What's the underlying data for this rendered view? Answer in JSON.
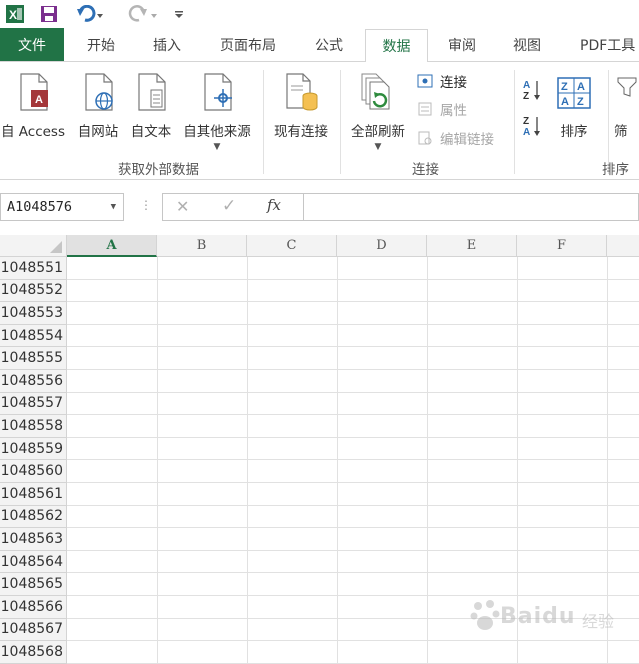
{
  "qat": {
    "app_icon": "excel-icon",
    "save_icon": "save-icon",
    "undo_icon": "undo-icon",
    "redo_icon": "redo-icon",
    "customize_icon": "customize-icon"
  },
  "tabs": [
    {
      "label": "文件"
    },
    {
      "label": "开始"
    },
    {
      "label": "插入"
    },
    {
      "label": "页面布局"
    },
    {
      "label": "公式"
    },
    {
      "label": "数据"
    },
    {
      "label": "审阅"
    },
    {
      "label": "视图"
    },
    {
      "label": "PDF工具"
    }
  ],
  "active_tab": "数据",
  "ribbon": {
    "get_external": {
      "group_label": "获取外部数据",
      "buttons": [
        {
          "label": "自 Access",
          "icon": "access-icon"
        },
        {
          "label": "自网站",
          "icon": "web-icon"
        },
        {
          "label": "自文本",
          "icon": "text-file-icon"
        },
        {
          "label": "自其他来源",
          "icon": "other-sources-icon"
        },
        {
          "label": "现有连接",
          "icon": "existing-connections-icon"
        }
      ]
    },
    "connections": {
      "group_label": "连接",
      "refresh_label": "全部刷新",
      "connections_label": "连接",
      "properties_label": "属性",
      "edit_links_label": "编辑链接"
    },
    "sort": {
      "group_label": "排序",
      "sort_label": "排序",
      "sort_az_icon": "sort-az-icon",
      "sort_za_icon": "sort-za-icon",
      "filter_label": "筛"
    }
  },
  "formula_bar": {
    "name_box": "A1048576",
    "formula": ""
  },
  "grid": {
    "columns": [
      "A",
      "B",
      "C",
      "D",
      "E",
      "F"
    ],
    "selected_column": "A",
    "rows": [
      "1048551",
      "1048552",
      "1048553",
      "1048554",
      "1048555",
      "1048556",
      "1048557",
      "1048558",
      "1048559",
      "1048560",
      "1048561",
      "1048562",
      "1048563",
      "1048564",
      "1048565",
      "1048566",
      "1048567",
      "1048568"
    ]
  },
  "watermark": {
    "text": "Baidu",
    "sub": "经验"
  },
  "colors": {
    "accent": "#217346",
    "ribbon_border": "#d5d5d5"
  }
}
